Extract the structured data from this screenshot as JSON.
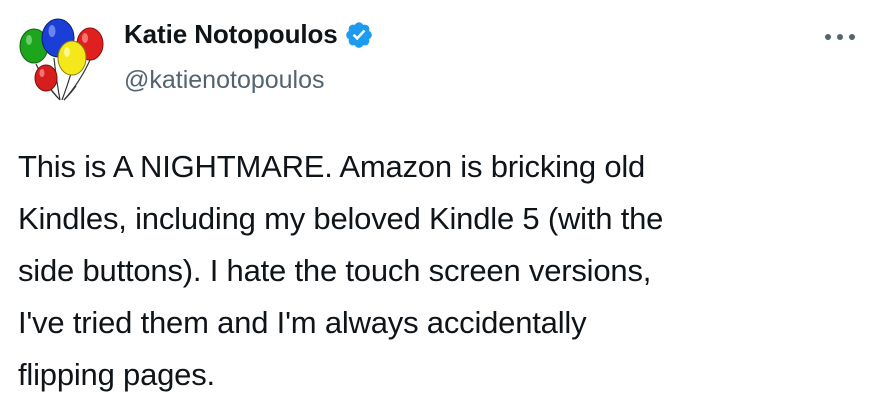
{
  "author": {
    "display_name": "Katie Notopoulos",
    "handle": "@katienotopoulos",
    "verified": true,
    "avatar_icon": "balloons-icon",
    "verified_icon": "verified-badge-icon",
    "verified_color": "#1d9bf0"
  },
  "more_button": {
    "icon": "more-dots-icon"
  },
  "tweet": {
    "lines": [
      "This is A NIGHTMARE. Amazon is bricking old",
      "Kindles, including my beloved Kindle 5 (with the",
      "side buttons). I hate the touch screen versions,",
      "I've tried them and I'm always accidentally",
      "flipping pages."
    ]
  },
  "colors": {
    "text": "#0f1419",
    "secondary_text": "#536471",
    "background": "#ffffff"
  }
}
